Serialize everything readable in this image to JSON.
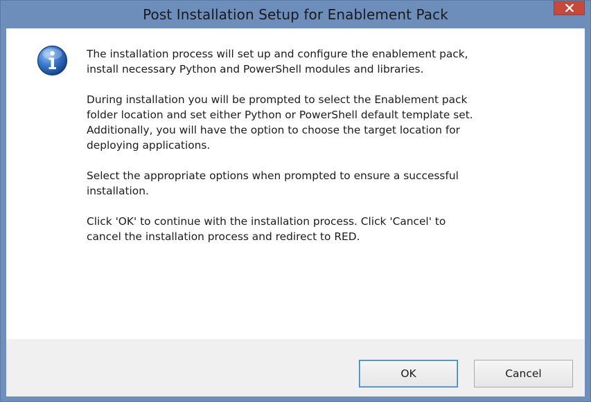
{
  "window": {
    "title": "Post Installation Setup for Enablement Pack",
    "close_label": "×"
  },
  "message": {
    "paragraphs": [
      [
        "The installation process will set up and configure the enablement pack,",
        "install necessary Python and PowerShell modules and libraries."
      ],
      [
        "During installation you will be prompted to select the Enablement pack",
        "folder location and set either Python or PowerShell default template set.",
        "Additionally, you will have the option to choose the target location for",
        "deploying applications."
      ],
      [
        "Select the appropriate options when prompted to ensure a successful",
        "installation."
      ],
      [
        "Click 'OK' to continue with the installation process. Click 'Cancel' to",
        "cancel the installation process and redirect to RED."
      ]
    ]
  },
  "buttons": {
    "ok_label": "OK",
    "cancel_label": "Cancel"
  },
  "icons": {
    "info": "info-icon",
    "close": "close-icon"
  },
  "colors": {
    "titlebar": "#6d8dbb",
    "close_button": "#c7493a",
    "button_bar": "#f0f0f0",
    "info_icon_blue": "#1f5fb3"
  }
}
